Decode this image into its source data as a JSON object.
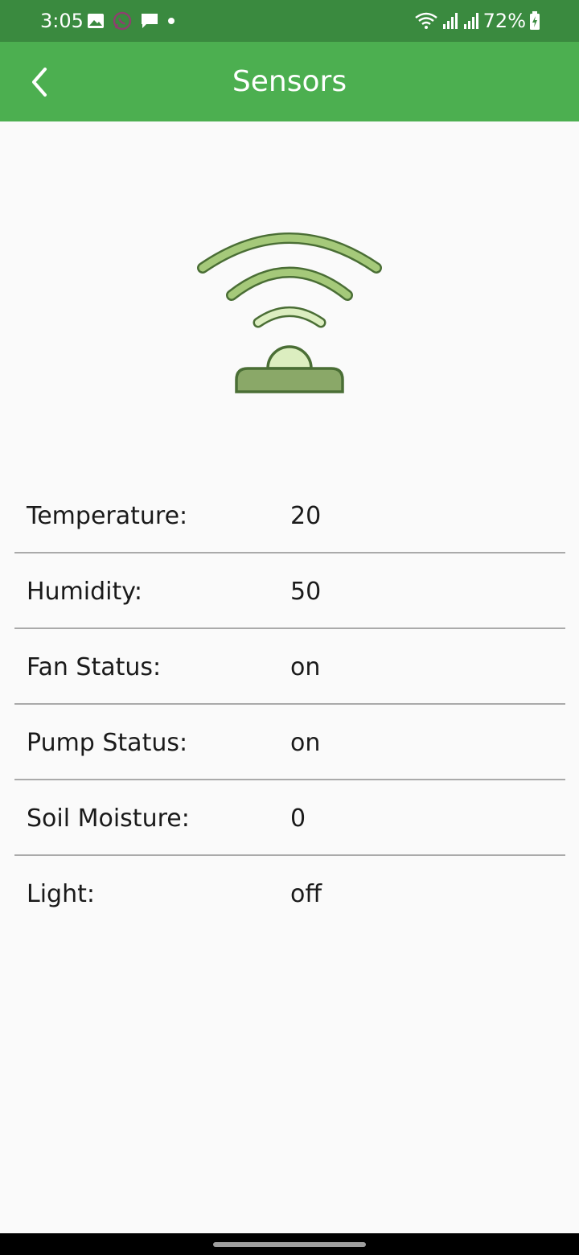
{
  "status_bar": {
    "time": "3:05",
    "battery": "72%",
    "left_icons": [
      "gallery-icon",
      "whatsapp-icon",
      "message-icon",
      "dot-icon"
    ],
    "right_icons": [
      "wifi-icon",
      "signal-icon",
      "signal-icon",
      "battery-icon"
    ],
    "background_color": "#3a8a3f"
  },
  "app_bar": {
    "title": "Sensors",
    "back_icon": "chevron-left-icon",
    "background_color": "#4caf50"
  },
  "illustration": {
    "icon": "wireless-sensor-icon",
    "colors": {
      "fill": "#a5c97a",
      "stroke": "#4a6e35",
      "base": "#8aa868",
      "bulb": "#dceec0"
    }
  },
  "sensors": [
    {
      "label": "Temperature:",
      "value": "20"
    },
    {
      "label": "Humidity:",
      "value": "50"
    },
    {
      "label": "Fan Status:",
      "value": "on"
    },
    {
      "label": "Pump Status:",
      "value": "on"
    },
    {
      "label": "Soil Moisture:",
      "value": "0"
    },
    {
      "label": "Light:",
      "value": "off"
    }
  ]
}
